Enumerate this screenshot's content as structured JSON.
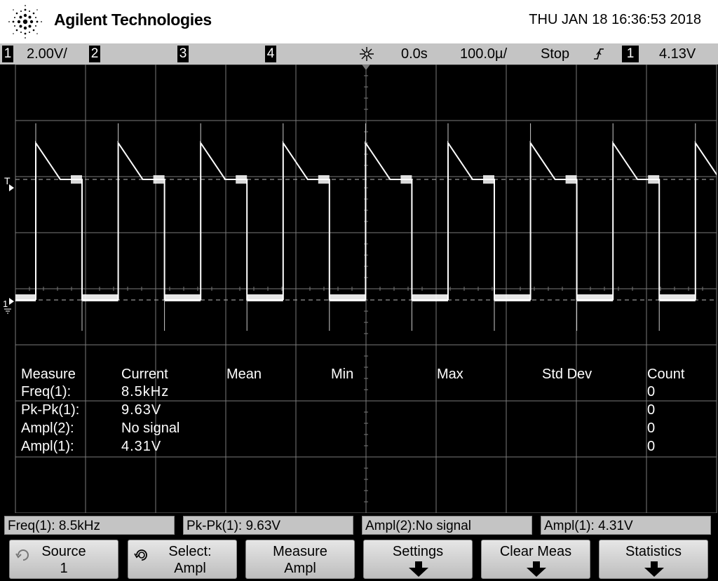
{
  "header": {
    "brand": "Agilent Technologies",
    "datetime": "THU JAN 18 16:36:53 2018"
  },
  "statusbar": {
    "ch1_label": "1",
    "ch1_scale": "2.00V/",
    "ch2_label": "2",
    "ch3_label": "3",
    "ch4_label": "4",
    "trigger_delay": "0.0s",
    "timebase": "100.0µ/",
    "run_state": "Stop",
    "trig_channel": "1",
    "trig_level": "4.13V"
  },
  "markers": {
    "trigger_level": "T",
    "ch1_ground": "1"
  },
  "measurements": {
    "headers": [
      "Measure",
      "Current",
      "Mean",
      "Min",
      "Max",
      "Std Dev",
      "Count"
    ],
    "rows": [
      {
        "name": "Freq(1):",
        "current": "8.5kHz",
        "count": "0"
      },
      {
        "name": "Pk-Pk(1):",
        "current": "9.63V",
        "count": "0"
      },
      {
        "name": "Ampl(2):",
        "current": "No signal",
        "count": "0"
      },
      {
        "name": "Ampl(1):",
        "current": "4.31V",
        "count": "0"
      }
    ]
  },
  "readouts": [
    "Freq(1): 8.5kHz",
    "Pk-Pk(1): 9.63V",
    "Ampl(2):No signal",
    "Ampl(1): 4.31V"
  ],
  "softkeys": [
    {
      "line1": "Source",
      "line2": "1",
      "icon": "knob-icon"
    },
    {
      "line1": "Select:",
      "line2": "Ampl",
      "icon": "knob-icon"
    },
    {
      "line1": "Measure",
      "line2": "Ampl",
      "icon": ""
    },
    {
      "line1": "Settings",
      "line2": "",
      "icon": "down-arrow-icon"
    },
    {
      "line1": "Clear Meas",
      "line2": "",
      "icon": "down-arrow-icon"
    },
    {
      "line1": "Statistics",
      "line2": "",
      "icon": "down-arrow-icon"
    }
  ],
  "colors": {
    "screen_bg": "#000000",
    "grid": "#7a7a7a",
    "trace": "#ffffff",
    "panel_gray": "#c4c4c4"
  }
}
